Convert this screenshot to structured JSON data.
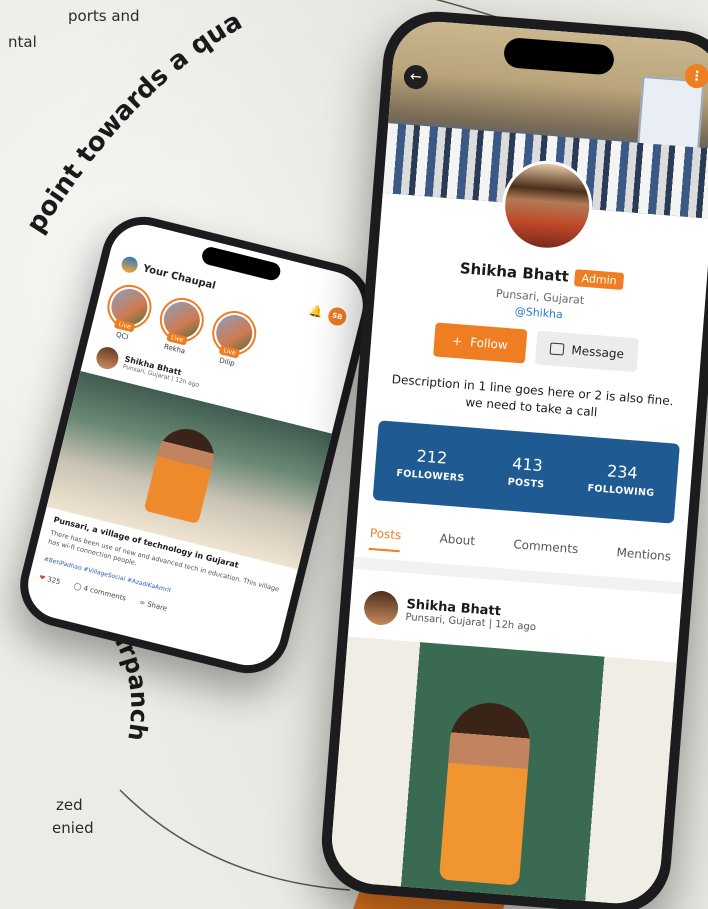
{
  "background": {
    "fragments": [
      "ports and",
      "ntal",
      "zed",
      "enied"
    ],
    "arc_text_top": "point towards a qua",
    "arc_text_left": "Sarpanch"
  },
  "left_phone": {
    "app_title": "Your Chaupal",
    "user_initials": "SB",
    "stories": [
      {
        "name": "QCI",
        "live": "Live"
      },
      {
        "name": "Rekha",
        "live": "Live"
      },
      {
        "name": "Dilip",
        "live": "Live"
      }
    ],
    "post": {
      "author": "Shikha Bhatt",
      "meta": "Punsari, Gujarat | 12h ago",
      "title": "Punsari, a village of technology in Gujarat",
      "body": "There has been use of new and advanced tech in education. This village has wi-fi connection people.",
      "tags": "#BetiPadhao #VillageSocial #AzadiKaAmrit",
      "likes": "325",
      "comments": "4 comments",
      "share": "Share"
    }
  },
  "right_phone": {
    "profile": {
      "name": "Shikha Bhatt",
      "badge": "Admin",
      "location": "Punsari, Gujarat",
      "handle": "@Shikha",
      "follow_label": "Follow",
      "message_label": "Message",
      "description": "Description in 1 line goes here or 2 is also fine. we need to take a call"
    },
    "stats": [
      {
        "value": "212",
        "label": "FOLLOWERS"
      },
      {
        "value": "413",
        "label": "POSTS"
      },
      {
        "value": "234",
        "label": "FOLLOWING"
      }
    ],
    "tabs": [
      "Posts",
      "About",
      "Comments",
      "Mentions"
    ],
    "post": {
      "author": "Shikha Bhatt",
      "meta": "Punsari, Gujarat | 12h ago"
    }
  },
  "colors": {
    "accent": "#ef7d22",
    "stats_bg": "#1f5a92",
    "link": "#2a7ac6"
  }
}
